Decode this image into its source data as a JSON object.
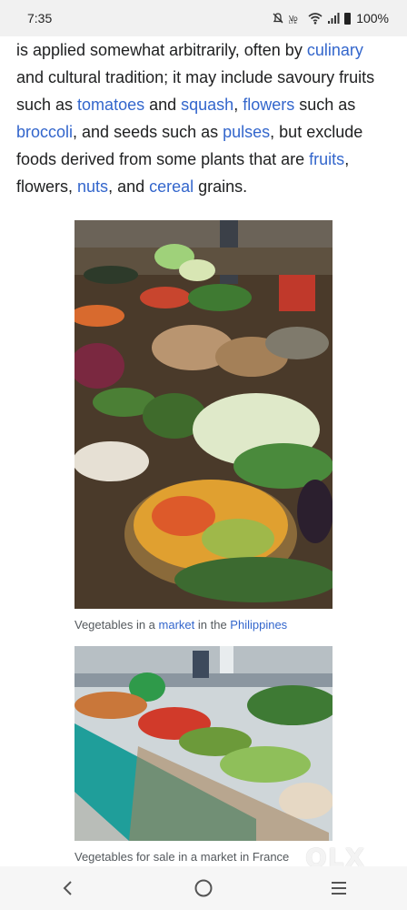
{
  "status_bar": {
    "time": "7:35",
    "battery_percent": "100%",
    "icons": [
      "mute-icon",
      "volte-icon",
      "wifi-icon",
      "signal-icon",
      "battery-icon"
    ]
  },
  "article": {
    "p1": "is applied somewhat arbitrarily, often by ",
    "link_culinary": "culinary",
    "p2": " and cultural tradition; it may include savoury fruits such as ",
    "link_tomatoes": "tomatoes",
    "p3": " and ",
    "link_squash": "squash",
    "p4": ", ",
    "link_flowers": "flowers",
    "p5": " such as ",
    "link_broccoli": "broccoli",
    "p6": ", and seeds such as ",
    "link_pulses": "pulses",
    "p7": ", but exclude foods derived from some plants that are ",
    "link_fruits": "fruits",
    "p8": ", flowers, ",
    "link_nuts": "nuts",
    "p9": ", and ",
    "link_cereal": "cereal",
    "p10": " grains."
  },
  "figure1": {
    "caption_a": "Vegetables in a ",
    "caption_link1": "market",
    "caption_b": " in the ",
    "caption_link2": "Philippines"
  },
  "figure2": {
    "caption": "Vegetables for sale in a market in France"
  },
  "watermark": "OLX",
  "colors": {
    "link": "#3366cc",
    "text": "#202122",
    "caption": "#54595d"
  }
}
